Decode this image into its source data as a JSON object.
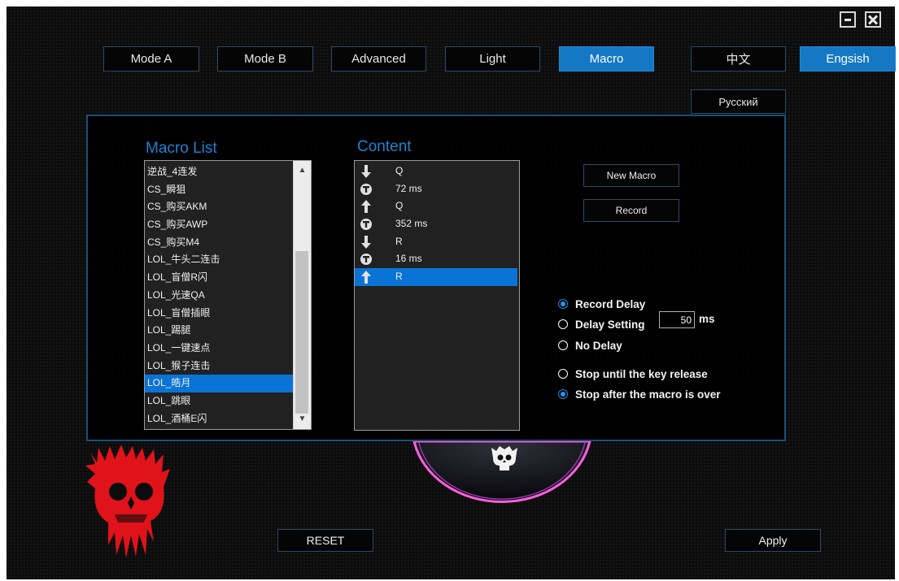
{
  "tabs": [
    {
      "label": "Mode A",
      "active": false
    },
    {
      "label": "Mode B",
      "active": false
    },
    {
      "label": "Advanced",
      "active": false
    },
    {
      "label": "Light",
      "active": false
    },
    {
      "label": "Macro",
      "active": true
    }
  ],
  "languages": {
    "chinese": "中文",
    "english": "Engsish",
    "russian": "Русский",
    "selected": "english"
  },
  "macro_list": {
    "heading": "Macro List",
    "items": [
      "逆战_4连发",
      "CS_瞬狙",
      "CS_购买AKM",
      "CS_购买AWP",
      "CS_购买M4",
      "LOL_牛头二连击",
      "LOL_盲僧R闪",
      "LOL_光速QA",
      "LOL_盲僧插眼",
      "LOL_踢腿",
      "LOL_一键速点",
      "LOL_猴子连击",
      "LOL_皓月",
      "LOL_跳眼",
      "LOL_酒桶E闪"
    ],
    "selected_index": 12
  },
  "content": {
    "heading": "Content",
    "rows": [
      {
        "icon": "arrow-down-icon",
        "text": "Q",
        "selected": false
      },
      {
        "icon": "timer-icon",
        "text": "72 ms",
        "selected": false
      },
      {
        "icon": "arrow-up-icon",
        "text": "Q",
        "selected": false
      },
      {
        "icon": "timer-icon",
        "text": "352 ms",
        "selected": false
      },
      {
        "icon": "arrow-down-icon",
        "text": "R",
        "selected": false
      },
      {
        "icon": "timer-icon",
        "text": "16 ms",
        "selected": false
      },
      {
        "icon": "arrow-up-icon",
        "text": "R",
        "selected": true
      }
    ]
  },
  "actions": {
    "new_macro": "New Macro",
    "record": "Record"
  },
  "delay_options": {
    "record_delay": "Record Delay",
    "delay_setting": "Delay Setting",
    "delay_value": "50",
    "delay_unit": "ms",
    "no_delay": "No Delay",
    "selected": "record_delay"
  },
  "stop_options": {
    "until_release": "Stop until the key release",
    "after_macro": "Stop after the macro is over",
    "selected": "after_macro"
  },
  "footer": {
    "reset": "RESET",
    "apply": "Apply"
  },
  "colors": {
    "accent": "#1578c4",
    "selection": "#0a74d6",
    "heading": "#1e82d2",
    "panel_border": "#1b4f7a",
    "skull_red": "#e0121a",
    "ring_pink": "#ff4fd8"
  }
}
